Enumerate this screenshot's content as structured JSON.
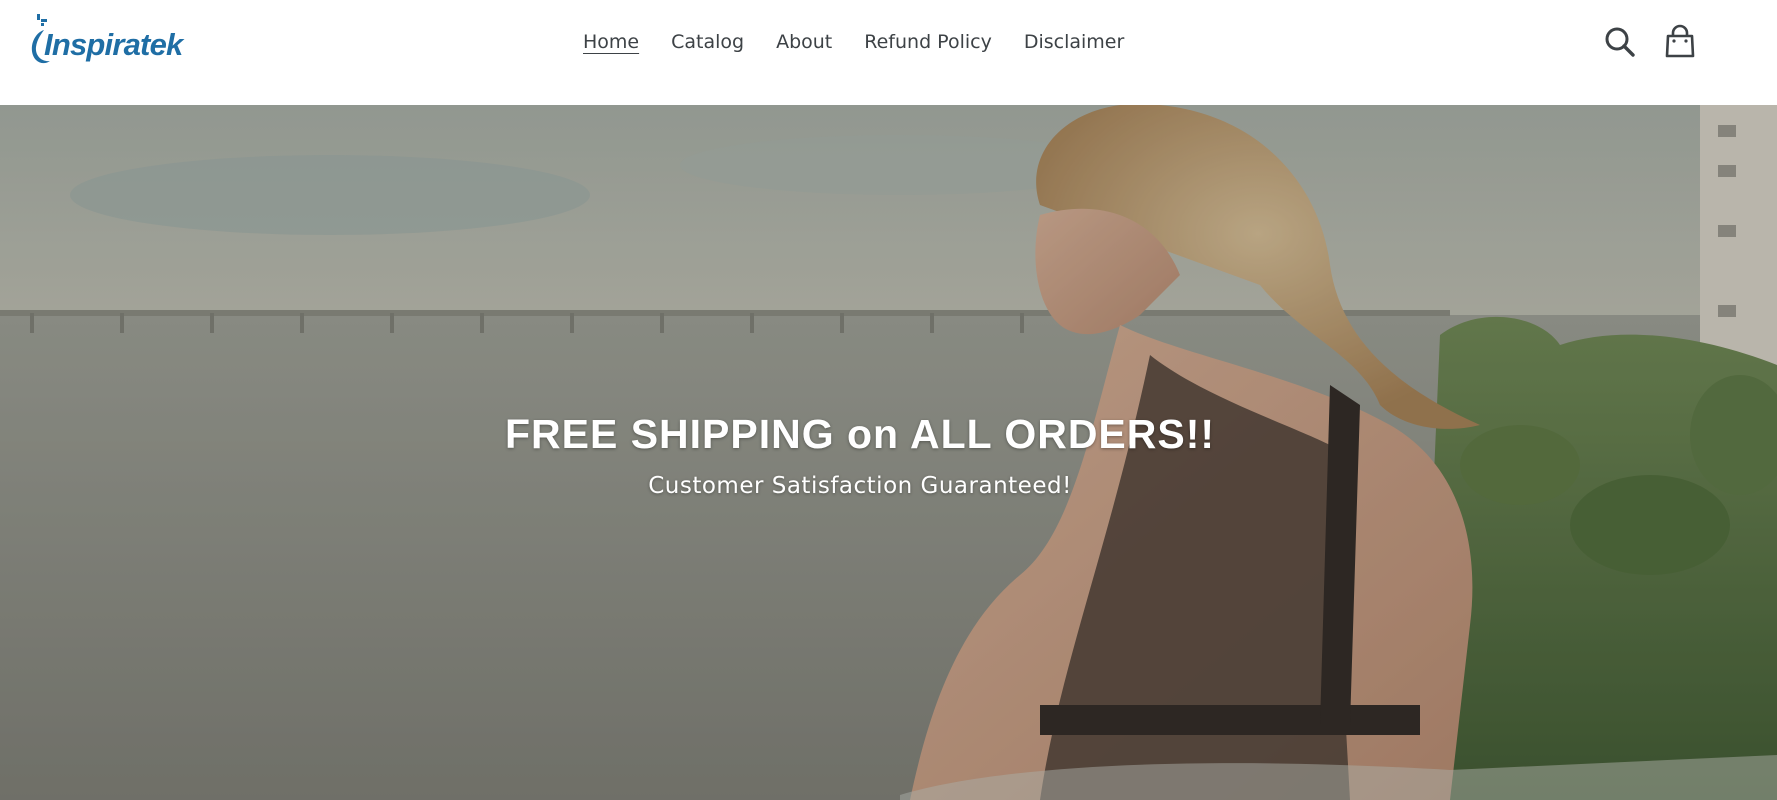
{
  "brand": {
    "name": "Inspiratek",
    "color": "#1f6ea5"
  },
  "nav": {
    "items": [
      {
        "label": "Home",
        "active": true
      },
      {
        "label": "Catalog",
        "active": false
      },
      {
        "label": "About",
        "active": false
      },
      {
        "label": "Refund Policy",
        "active": false
      },
      {
        "label": "Disclaimer",
        "active": false
      }
    ],
    "text_color": "#3d4246"
  },
  "header_icons": {
    "search": "search-icon",
    "cart": "cart-icon"
  },
  "hero": {
    "title": "FREE SHIPPING on ALL ORDERS!!",
    "subtitle": "Customer Satisfaction Guaranteed!",
    "image": "woman-wearing-posture-corrector-by-waterfront"
  }
}
